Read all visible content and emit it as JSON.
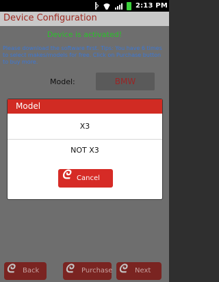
{
  "status_bar": {
    "time": "2:13 PM"
  },
  "title_bar": {
    "title": "Device Configuration"
  },
  "content": {
    "activated_text": "Device is activated!",
    "info_text": "Please download the software first. Tips: You have 6 times to select makes/models for free. Click on Purchase button to buy more.",
    "model_label": "Model:",
    "model_value": "BMW"
  },
  "buttons": {
    "back": "Back",
    "purchase": "Purchase",
    "next": "Next"
  },
  "dialog": {
    "title": "Model",
    "options": [
      "X3",
      "NOT X3"
    ],
    "cancel": "Cancel"
  },
  "colors": {
    "dialog_accent": "#d12b23",
    "activated_green": "#2bc12b",
    "info_blue": "#3c78d6",
    "title_text": "#9e2a21"
  },
  "icons": [
    "bluetooth-icon",
    "wifi-icon",
    "signal-icon",
    "battery-icon",
    "swirl-logo-icon"
  ]
}
